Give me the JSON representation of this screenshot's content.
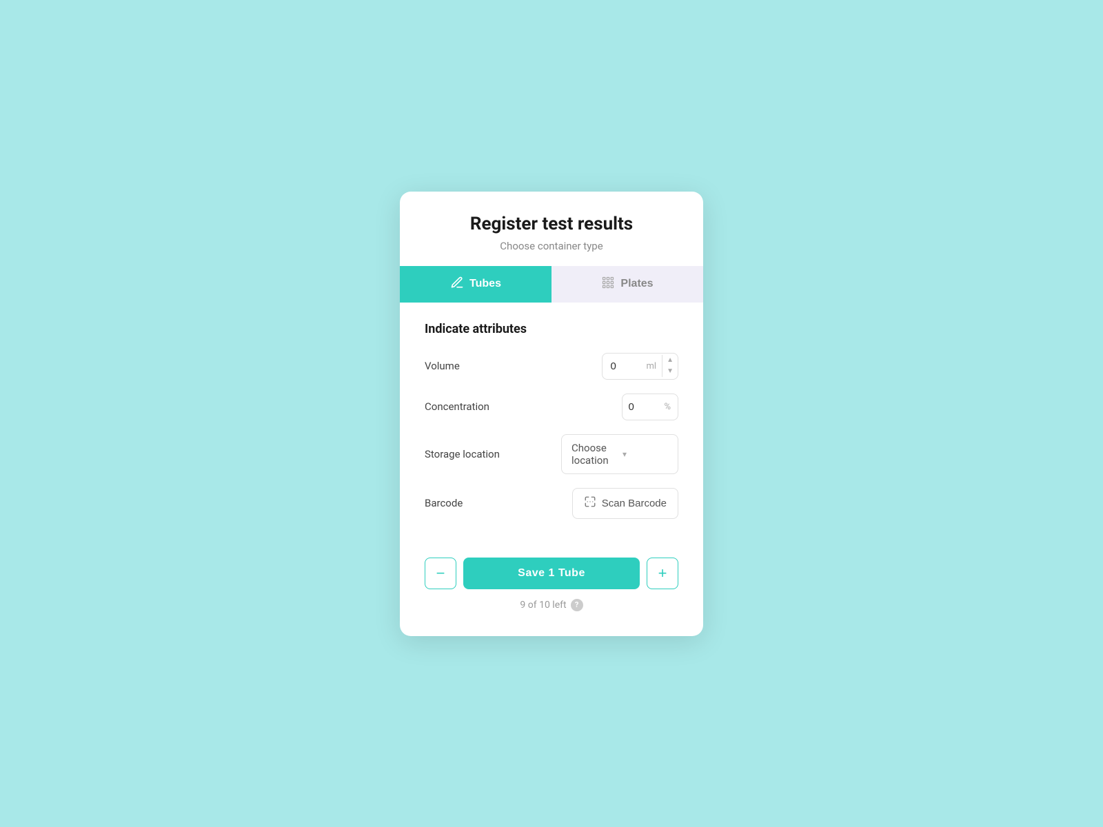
{
  "background_color": "#a8e8e8",
  "modal": {
    "title": "Register test results",
    "subtitle": "Choose container type"
  },
  "tabs": {
    "tubes_label": "Tubes",
    "plates_label": "Plates",
    "active": "tubes"
  },
  "section": {
    "title": "Indicate attributes"
  },
  "fields": {
    "volume_label": "Volume",
    "volume_value": "0",
    "volume_unit": "ml",
    "concentration_label": "Concentration",
    "concentration_value": "0",
    "concentration_unit": "%",
    "storage_location_label": "Storage location",
    "storage_location_placeholder": "Choose location",
    "barcode_label": "Barcode",
    "scan_barcode_label": "Scan Barcode"
  },
  "actions": {
    "minus_label": "−",
    "save_label": "Save 1 Tube",
    "plus_label": "+"
  },
  "footer": {
    "info_text": "9 of 10 left",
    "help_label": "?"
  },
  "icons": {
    "tubes_icon": "✏",
    "plates_icon": "⊞",
    "chevron_down": "▾",
    "scan_icon": "⊹"
  }
}
